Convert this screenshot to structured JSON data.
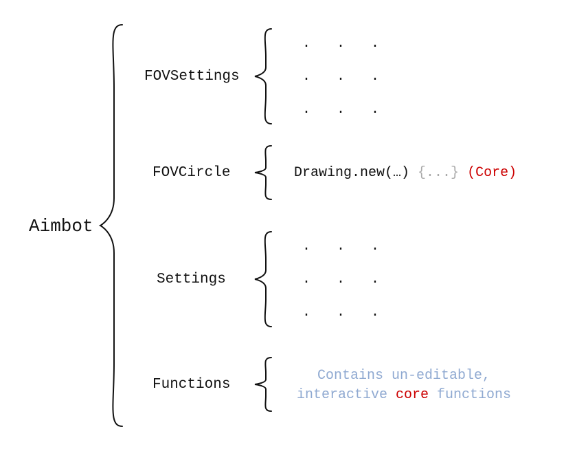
{
  "root": {
    "label": "Aimbot"
  },
  "children": [
    {
      "label": "FOVSettings"
    },
    {
      "label": "FOVCircle"
    },
    {
      "label": "Settings"
    },
    {
      "label": "Functions"
    }
  ],
  "fovcircle": {
    "call": "Drawing.new(…)",
    "placeholder": "{...}",
    "tag": "(Core)"
  },
  "functions": {
    "line1_pre": "Contains un-editable,",
    "line2_pre": "interactive ",
    "line2_core": "core",
    "line2_post": " functions"
  },
  "dots": {
    "char": "."
  }
}
